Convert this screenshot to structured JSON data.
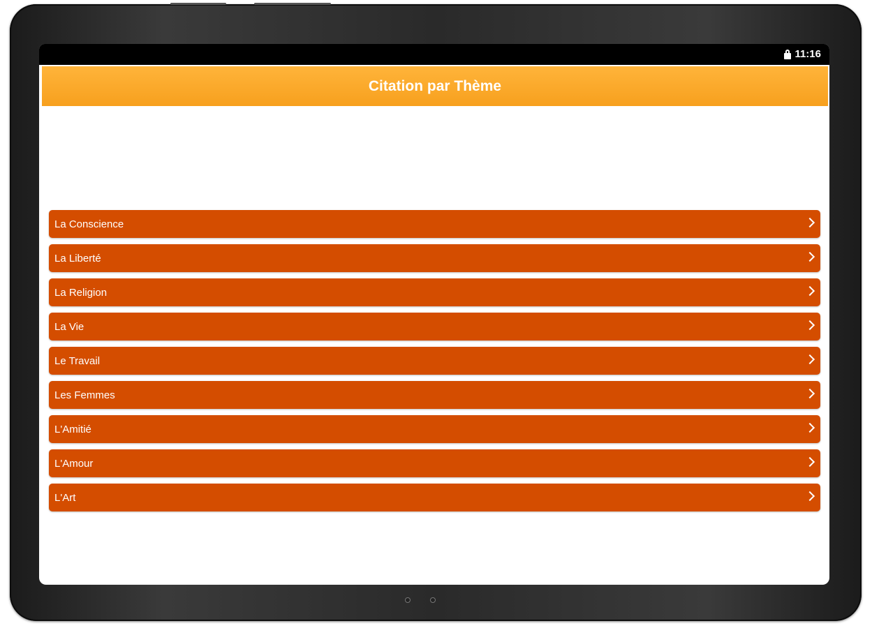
{
  "status_bar": {
    "time": "11:16",
    "icons": [
      "lock-icon"
    ]
  },
  "app_bar": {
    "title": "Citation par Thème",
    "color": "#f7a01e"
  },
  "themes": {
    "items": [
      {
        "label": "La Conscience"
      },
      {
        "label": "La Liberté"
      },
      {
        "label": "La Religion"
      },
      {
        "label": "La Vie"
      },
      {
        "label": "Le Travail"
      },
      {
        "label": "Les Femmes"
      },
      {
        "label": "L'Amitié"
      },
      {
        "label": "L'Amour"
      },
      {
        "label": "L'Art"
      }
    ],
    "item_color": "#d44d00",
    "icon": "chevron-right-icon"
  }
}
